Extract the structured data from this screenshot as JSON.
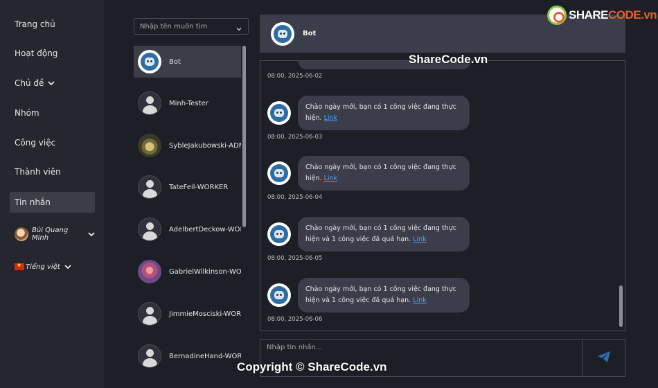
{
  "nav": {
    "home": "Trang chủ",
    "activity": "Hoạt động",
    "topics": "Chủ đề",
    "groups": "Nhóm",
    "tasks": "Công việc",
    "members": "Thành viên",
    "messages": "Tin nhắn",
    "user_name": "Bùi Quang Minh",
    "language": "Tiếng việt"
  },
  "contacts": {
    "search_placeholder": "Nhập tên muốn tìm",
    "items": [
      {
        "name": "Bot",
        "avatar": "bot-icon"
      },
      {
        "name": "Minh-Tester",
        "avatar": "user-icon"
      },
      {
        "name": "SybleJakubowski-ADM",
        "avatar": "photo"
      },
      {
        "name": "TateFeil-WORKER",
        "avatar": "user-icon"
      },
      {
        "name": "AdelbertDeckow-WOR",
        "avatar": "user-icon"
      },
      {
        "name": "GabrielWilkinson-WO",
        "avatar": "photo"
      },
      {
        "name": "JimmieMosciski-WOR",
        "avatar": "user-icon"
      },
      {
        "name": "BernadineHand-WOR",
        "avatar": "user-icon"
      }
    ]
  },
  "chat": {
    "title": "Bot",
    "messages": [
      {
        "time": "08:00, 2025-06-02"
      },
      {
        "text": "Chào ngày mới, bạn có 1 công việc đang thực hiện.",
        "link": "Link",
        "time": "08:00, 2025-06-03"
      },
      {
        "text": "Chào ngày mới, bạn có 1 công việc đang thực hiện.",
        "link": "Link",
        "time": "08:00, 2025-06-04"
      },
      {
        "text": "Chào ngày mới, bạn có 1 công việc đang thực hiện và 1 công việc đã quá hạn.",
        "link": "Link",
        "time": "08:00, 2025-06-05"
      },
      {
        "text": "Chào ngày mới, bạn có 1 công việc đang thực hiện và 1 công việc đã quá hạn.",
        "link": "Link",
        "time": "08:00, 2025-06-06"
      }
    ],
    "input_placeholder": "Nhập tin nhắn..."
  },
  "watermarks": {
    "logo_prefix": "SHARE",
    "logo_suffix": "CODE.vn",
    "center": "ShareCode.vn",
    "footer": "Copyright © ShareCode.vn"
  },
  "colors": {
    "accent_link": "#4da3ff",
    "send_icon": "#2e6db4"
  }
}
